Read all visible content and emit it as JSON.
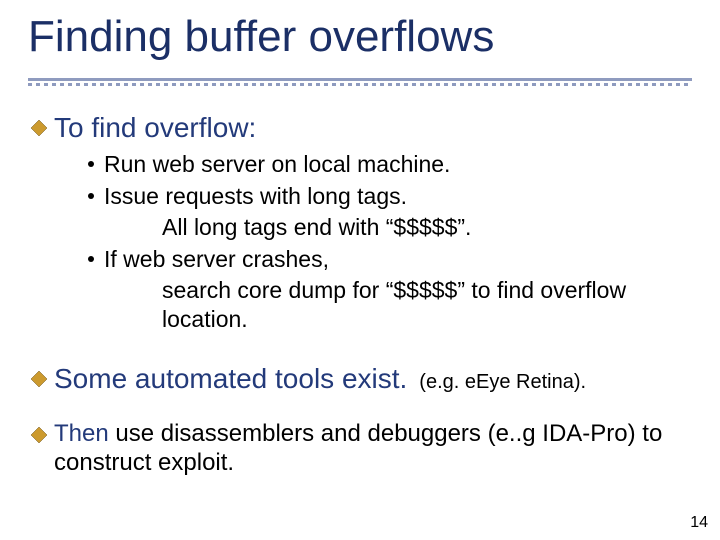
{
  "slide": {
    "title": "Finding buffer overflows",
    "page_number": "14"
  },
  "section1": {
    "heading": "To find overflow:",
    "items": [
      "Run web server on local machine.",
      "Issue requests with long tags.",
      "All long tags end with   “$$$$$”.",
      "If web server crashes,",
      "search core dump for  “$$$$$” to find overflow location."
    ]
  },
  "section2": {
    "heading": "Some automated tools exist.",
    "note": "(e.g.  eEye Retina)."
  },
  "section3": {
    "lead": "Then",
    "rest": " use disassemblers and debuggers (e..g IDA-Pro) to construct exploit."
  }
}
